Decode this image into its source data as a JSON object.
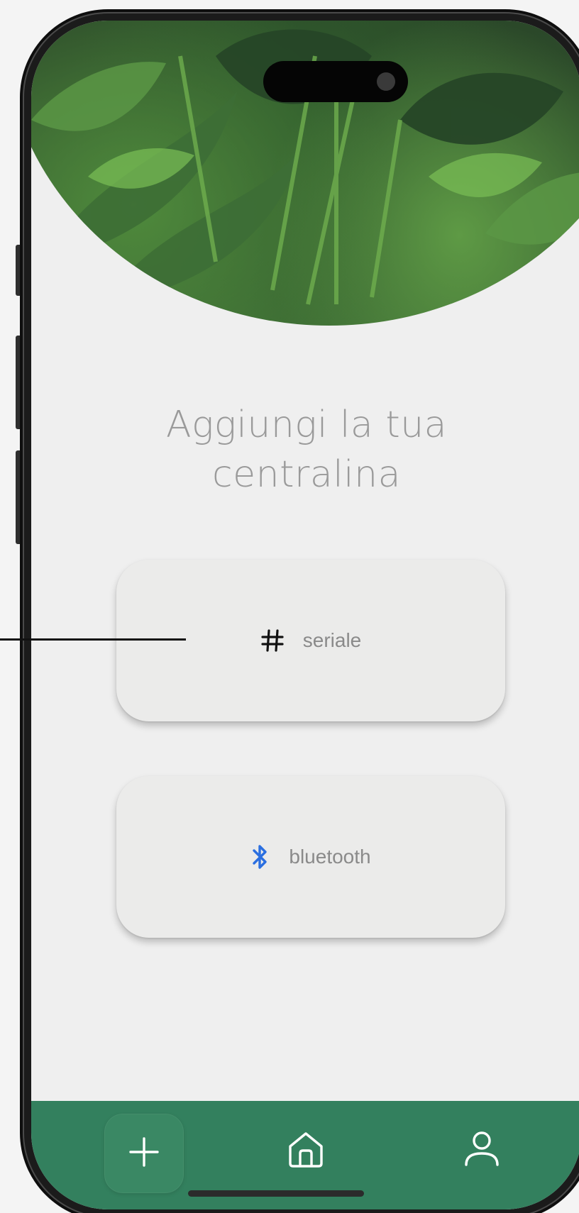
{
  "heading": {
    "line1": "Aggiungi la tua",
    "line2": "centralina"
  },
  "options": {
    "serial": {
      "label": "seriale",
      "icon": "hash-icon"
    },
    "bluetooth": {
      "label": "bluetooth",
      "icon": "bluetooth-icon"
    }
  },
  "nav": {
    "items": [
      {
        "name": "add",
        "icon": "plus-icon"
      },
      {
        "name": "home",
        "icon": "home-icon"
      },
      {
        "name": "profile",
        "icon": "user-icon"
      }
    ]
  },
  "colors": {
    "accent_green": "#33805e",
    "card_bg": "#ebebea",
    "bluetooth_blue": "#2b6fe0"
  }
}
